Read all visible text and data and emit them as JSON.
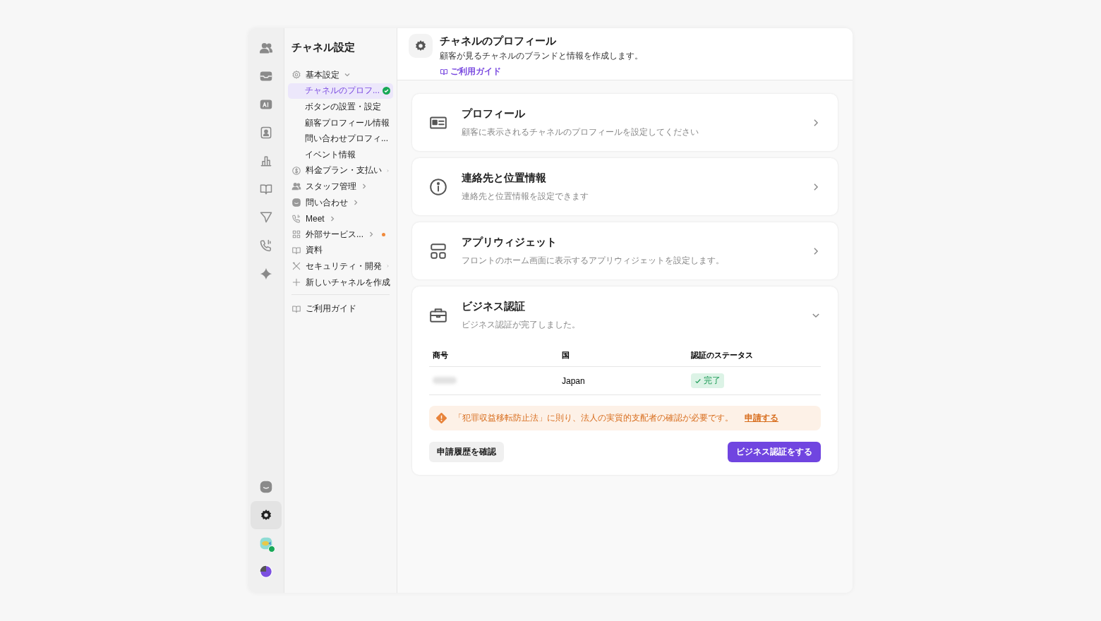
{
  "rail": {
    "top": [
      {
        "selected": false
      },
      {
        "selected": false
      },
      {
        "selected": false
      },
      {
        "selected": false
      },
      {
        "selected": false
      },
      {
        "selected": false
      },
      {
        "selected": false
      },
      {
        "selected": false
      },
      {
        "selected": false
      }
    ],
    "bottom": [
      {
        "kind": "chat",
        "selected": false
      },
      {
        "kind": "settings",
        "selected": true
      },
      {
        "kind": "avatar",
        "online": true,
        "selected": false
      },
      {
        "kind": "workspace",
        "selected": false
      }
    ]
  },
  "nav": {
    "title": "チャネル設定",
    "items": [
      {
        "label": "基本設定",
        "expanded": true,
        "children": [
          {
            "label": "チャネルのプロフ...",
            "selected": true,
            "verified": true
          },
          {
            "label": "ボタンの設置・設定",
            "selected": false,
            "verified": false
          },
          {
            "label": "顧客プロフィール情報",
            "selected": false,
            "verified": false
          },
          {
            "label": "問い合わせプロフィ...",
            "selected": false,
            "verified": false
          },
          {
            "label": "イベント情報",
            "selected": false,
            "verified": false
          }
        ]
      },
      {
        "label": "料金プラン・支払い",
        "expanded": false
      },
      {
        "label": "スタッフ管理",
        "expanded": false
      },
      {
        "label": "問い合わせ",
        "expanded": false
      },
      {
        "label": "Meet",
        "expanded": false
      },
      {
        "label": "外部サービス...",
        "expanded": false,
        "color": "#f08a3c"
      },
      {
        "label": "資料"
      },
      {
        "label": "セキュリティ・開発",
        "expanded": false
      },
      {
        "label": "新しいチャネルを作成"
      }
    ],
    "guide": "ご利用ガイド"
  },
  "header": {
    "title": "チャネルのプロフィール",
    "subtitle": "顧客が見るチャネルのブランドと情報を作成します。",
    "guide_link": "ご利用ガイド"
  },
  "cards": [
    {
      "title": "プロフィール",
      "description": "顧客に表示されるチャネルのプロフィールを設定してください",
      "expanded": false
    },
    {
      "title": "連絡先と位置情報",
      "description": "連絡先と位置情報を設定できます",
      "expanded": false
    },
    {
      "title": "アプリウィジェット",
      "description": "フロントのホーム画面に表示するアプリウィジェットを設定します。",
      "expanded": false
    },
    {
      "title": "ビジネス認証",
      "description": "ビジネス認証が完了しました。",
      "expanded": true,
      "table": {
        "columns": [
          "商号",
          "国",
          "認証のステータス"
        ],
        "rows": [
          [
            {
              "kind": "blurred"
            },
            {
              "kind": "text",
              "text": "Japan"
            },
            {
              "kind": "status",
              "text": "完了"
            }
          ]
        ]
      },
      "notice": {
        "text": "「犯罪収益移転防止法」に則り、法人の実質的支配者の確認が必要です。",
        "link": "申請する"
      },
      "secondary_button": "申請履歴を確認",
      "primary_button": "ビジネス認証をする"
    }
  ]
}
